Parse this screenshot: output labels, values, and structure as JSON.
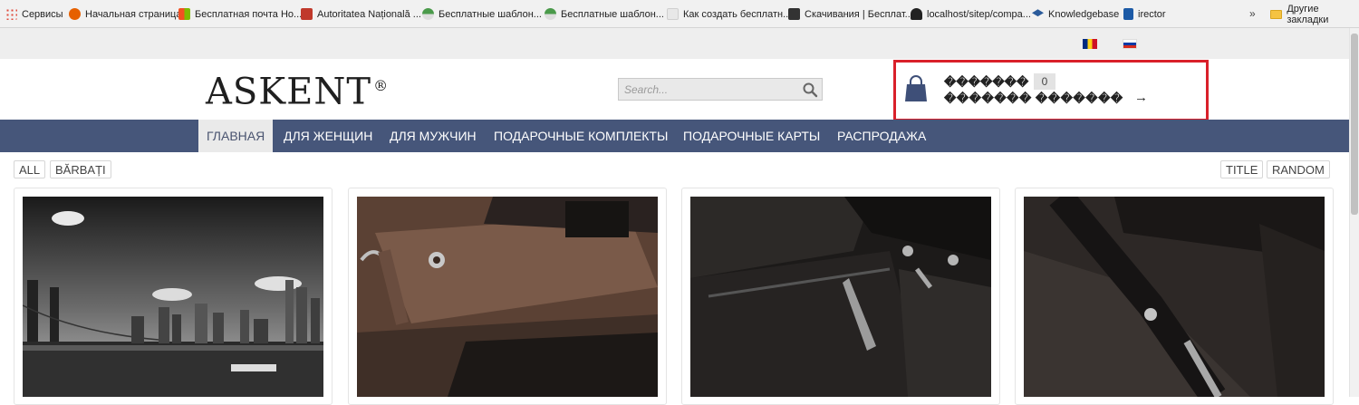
{
  "bookmarks": [
    {
      "label": "Сервисы",
      "icon": "apps-grid-icon",
      "color": "#e04b3c"
    },
    {
      "label": "Начальная страница",
      "icon": "firefox-icon",
      "color": "#e66000"
    },
    {
      "label": "Бесплатная почта Ho...",
      "icon": "windows-icon",
      "color": "#2d7cd6"
    },
    {
      "label": "Autoritatea Națională ...",
      "icon": "anc-icon",
      "color": "#c0392b"
    },
    {
      "label": "Бесплатные шаблон...",
      "icon": "template-site-icon",
      "color": "#4a9a4a"
    },
    {
      "label": "Бесплатные шаблон...",
      "icon": "template-site-icon",
      "color": "#4a9a4a"
    },
    {
      "label": "Как создать бесплатн...",
      "icon": "page-icon",
      "color": "#cfcfcf"
    },
    {
      "label": "Скачивания | Бесплат...",
      "icon": "joomla-icon",
      "color": "#333333"
    },
    {
      "label": "localhost/sitep/compa...",
      "icon": "spy-icon",
      "color": "#222222"
    },
    {
      "label": "Knowledgebase",
      "icon": "graduation-cap-icon",
      "color": "#2b5b9b"
    },
    {
      "label": "irector",
      "icon": "e-icon",
      "color": "#1c5aa6"
    }
  ],
  "bookmarks_more": "»",
  "other_bookmarks": "Другие закладки",
  "header": {
    "logo": "ASKENT",
    "logo_mark": "®",
    "search_placeholder": "Search...",
    "cart_title": "�������",
    "cart_count": "0",
    "cart_link": "������� �������",
    "cart_arrow": "→"
  },
  "nav": [
    {
      "label": "ГЛАВНАЯ",
      "active": true
    },
    {
      "label": "ДЛЯ ЖЕНЩИН",
      "active": false
    },
    {
      "label": "ДЛЯ МУЖЧИН",
      "active": false
    },
    {
      "label": "ПОДАРОЧНЫЕ КОМПЛЕКТЫ",
      "active": false
    },
    {
      "label": "ПОДАРОЧНЫЕ КАРТЫ",
      "active": false
    },
    {
      "label": "РАСПРОДАЖА",
      "active": false
    }
  ],
  "filters": {
    "left": [
      "ALL",
      "BĂRBAȚI"
    ],
    "right": [
      "TITLE",
      "RANDOM"
    ]
  },
  "colors": {
    "nav_bg": "#46567a",
    "highlight": "#d9202a",
    "cart_icon": "#3e4f78"
  }
}
